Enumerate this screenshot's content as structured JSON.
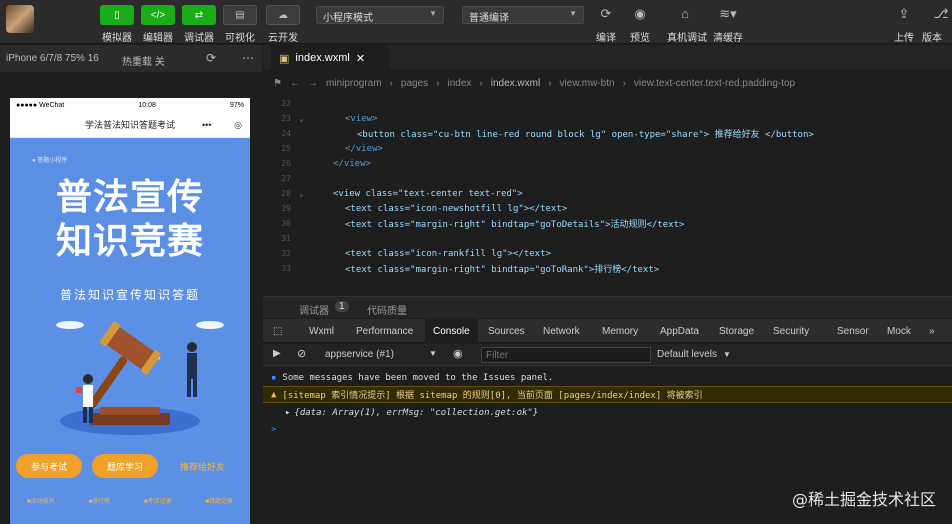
{
  "toolbar": {
    "simulator": "模拟器",
    "editor": "编辑器",
    "debugger": "调试器",
    "visual": "可视化",
    "cloud": "云开发",
    "mode_select": "小程序模式",
    "compile_select": "普通编译",
    "compile": "编译",
    "preview": "预览",
    "remote_debug": "真机调试",
    "clear_cache": "清缓存",
    "upload": "上传",
    "version": "版本"
  },
  "sim_header": {
    "device": "iPhone 6/7/8 75% 16",
    "hot_reload": "热重载 关"
  },
  "phone": {
    "carrier": "●●●●● WeChat",
    "time": "10:08",
    "battery": "97%",
    "nav_title": "学法普法知识答题考试",
    "small_tag": "● 答题小程序",
    "title_line1": "普法宣传",
    "title_line2": "知识竞赛",
    "subtitle": "普法知识宣传知识答题",
    "btn_exam": "参与考试",
    "btn_practice": "题库学习",
    "link_share": "推荐给好友",
    "bottom": [
      "■活动规则",
      "■排行榜",
      "■考试记录",
      "■错题记录"
    ]
  },
  "editor": {
    "tab": "index.wxml",
    "breadcrumb": [
      "miniprogram",
      "pages",
      "index",
      "index.wxml",
      "view.mw-btn",
      "view.text-center.text-red.padding-top"
    ],
    "lines": [
      {
        "n": "22",
        "html": ""
      },
      {
        "n": "23",
        "tag1": "<view>"
      },
      {
        "n": "24",
        "code": "<button class=\"cu-btn line-red round block lg\" open-type=\"share\"> 推荐给好友 </button>"
      },
      {
        "n": "25",
        "tag1": "</view>"
      },
      {
        "n": "26",
        "tag1": "</view>"
      },
      {
        "n": "27",
        "code": ""
      },
      {
        "n": "28",
        "code": "<view class=\"text-center text-red\">"
      },
      {
        "n": "29",
        "code": "<text class=\"icon-newshotfill lg\"></text>"
      },
      {
        "n": "30",
        "code": "<text class=\"margin-right\" bindtap=\"goToDetails\">活动规则</text>"
      },
      {
        "n": "31",
        "code": ""
      },
      {
        "n": "32",
        "code": "<text class=\"icon-rankfill lg\"></text>"
      },
      {
        "n": "33",
        "code": "<text class=\"margin-right\" bindtap=\"goToRank\">排行榜</text>"
      }
    ]
  },
  "panel": {
    "debugger": "调试器",
    "badge": "1",
    "code_quality": "代码质量"
  },
  "devtools": {
    "tabs": [
      "Wxml",
      "Performance",
      "Console",
      "Sources",
      "Network",
      "Memory",
      "AppData",
      "Storage",
      "Security",
      "Sensor",
      "Mock"
    ],
    "active": "Console",
    "more": "»"
  },
  "console_bar": {
    "context": "appservice (#1)",
    "filter_placeholder": "Filter",
    "levels": "Default levels"
  },
  "console": {
    "info": "Some messages have been moved to the Issues panel.",
    "warn": "[sitemap 索引情况提示] 根据 sitemap 的规则[0], 当前页面 [pages/index/index] 将被索引",
    "obj": "{data: Array(1), errMsg: \"collection.get:ok\"}",
    "prompt": ">"
  },
  "watermark": "@稀土掘金技术社区"
}
